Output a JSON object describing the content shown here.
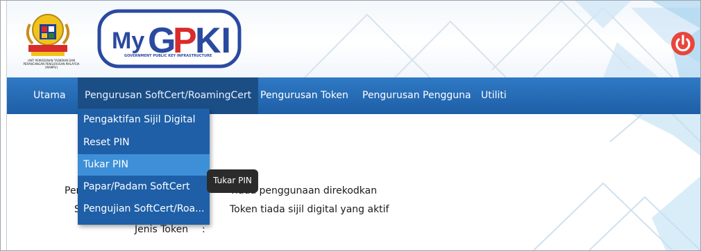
{
  "header": {
    "agency_text": "UNIT PEMODENAN TADBIRAN DAN PERANCANGAN PENGURUSAN MALAYSIA (MAMPU)",
    "logo_brand": "MyGPKI",
    "logo_subtitle": "GOVERNMENT PUBLIC KEY INFRASTRUCTURE",
    "power_icon": "power-icon"
  },
  "nav": {
    "items": [
      {
        "label": "Utama"
      },
      {
        "label": "Pengurusan SoftCert/RoamingCert"
      },
      {
        "label": "Pengurusan Token"
      },
      {
        "label": "Pengurusan Pengguna"
      },
      {
        "label": "Utiliti"
      }
    ]
  },
  "dropdown": {
    "items": [
      {
        "label": "Pengaktifan Sijil Digital"
      },
      {
        "label": "Reset PIN"
      },
      {
        "label": "Tukar PIN"
      },
      {
        "label": "Papar/Padam SoftCert"
      },
      {
        "label": "Pengujian SoftCert/Roa..."
      }
    ]
  },
  "tooltip": {
    "text": "Tukar PIN"
  },
  "fields": [
    {
      "label_visible": "Peng",
      "value": "Tiada penggunaan direkodkan"
    },
    {
      "label_visible": "S",
      "value": "Token tiada sijil digital yang aktif"
    },
    {
      "label_visible": "Jenis Token",
      "colon": ":",
      "value": ""
    }
  ],
  "colors": {
    "nav_bg": "#1e5fa7",
    "nav_active": "#1c4e86",
    "dropdown_hover": "#3d8fd8",
    "power_red": "#e8453c"
  }
}
